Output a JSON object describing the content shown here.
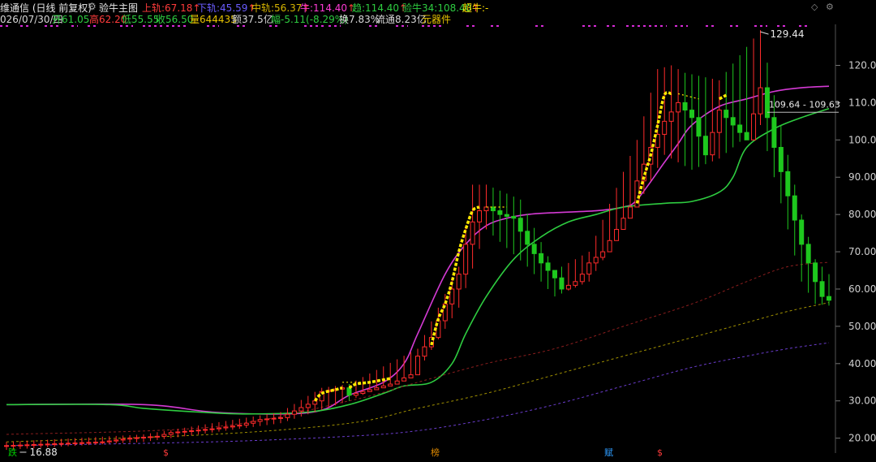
{
  "header": {
    "stock_title": "维通信 (日线 前复权)",
    "main_name": "验牛主图",
    "indicators": [
      {
        "label": "上轨:",
        "value": "67.18",
        "color": "#ff3b3b",
        "arrow": "↑",
        "arrow_color": "#ff3b3b"
      },
      {
        "label": "下轨:",
        "value": "45.59",
        "color": "#6a5cff",
        "arrow": "↑",
        "arrow_color": "#ff3b3b"
      },
      {
        "label": "中轨:",
        "value": "56.37",
        "color": "#d6b400",
        "arrow": "↑",
        "arrow_color": "#ff3b3b"
      },
      {
        "label": "牛:",
        "value": "114.40",
        "color": "#ff3bd5",
        "arrow": "↑",
        "arrow_color": "#ff3b3b"
      },
      {
        "label": "趋:",
        "value": "114.40",
        "color": "#2ecc40",
        "arrow": "↑",
        "arrow_color": "#ff3b3b"
      },
      {
        "label": "验牛34:",
        "value": "108.40",
        "color": "#2ecc40",
        "arrow": "↑",
        "arrow_color": "#ff3b3b"
      },
      {
        "label": "超牛:",
        "value": "-",
        "color": "#ffe000",
        "arrow": "",
        "arrow_color": "#ff3b3b"
      }
    ],
    "ohlc": {
      "date": "026/07/30/四",
      "open_label": "开",
      "open": "61.05",
      "high_label": "高",
      "high": "62.20",
      "low_label": "低",
      "low": "55.55",
      "close_label": "收",
      "close": "56.50",
      "vol_label": "量",
      "vol": "644435",
      "amount_label": "额",
      "amount": "37.5亿",
      "change_label": "幅",
      "change": "-5.11(-8.29%)",
      "turnover_label": "换",
      "turnover": "7.83%",
      "float_label": "流通",
      "float": "8.23亿",
      "sector": "元器件"
    }
  },
  "annotations": {
    "max_label": "129.44",
    "min_label": "16.88",
    "range_label": "109.64 - 109.63"
  },
  "bottom_markers": [
    {
      "text": "跌",
      "color": "#00c800",
      "pos": 0.006
    },
    {
      "text": "$",
      "color": "#ff3b3b",
      "pos": 0.197
    },
    {
      "text": "榜",
      "color": "#e08a00",
      "pos": 0.527
    },
    {
      "text": "赋",
      "color": "#2e9cff",
      "pos": 0.741
    },
    {
      "text": "$",
      "color": "#ff3b3b",
      "pos": 0.806
    }
  ],
  "chart_data": {
    "type": "candlestick",
    "y_ticks": [
      20,
      30,
      40,
      50,
      60,
      70,
      80,
      90,
      100,
      110,
      120
    ],
    "ylim": [
      16,
      131
    ],
    "y_tick_labels": [
      "20.00",
      "30.00",
      "40.00",
      "50.00",
      "60.00",
      "70.00",
      "80.00",
      "90.00",
      "100.00",
      "110.00",
      "120.00"
    ],
    "closes": [
      [
        0,
        18
      ],
      [
        14,
        19
      ],
      [
        18,
        20
      ],
      [
        22,
        20.5
      ],
      [
        24,
        21.5
      ],
      [
        30,
        22.5
      ],
      [
        34,
        23.5
      ],
      [
        37,
        25
      ],
      [
        40,
        25.5
      ],
      [
        45,
        30
      ],
      [
        46,
        32.5
      ],
      [
        49,
        33.5
      ],
      [
        50,
        31.5
      ],
      [
        53,
        33
      ],
      [
        56,
        34.5
      ],
      [
        59,
        37
      ],
      [
        60,
        42
      ],
      [
        62,
        47
      ],
      [
        64,
        56
      ],
      [
        66,
        64
      ],
      [
        67,
        72
      ],
      [
        68,
        78
      ],
      [
        69,
        81
      ],
      [
        70,
        82
      ],
      [
        72,
        80
      ],
      [
        74,
        79
      ],
      [
        76,
        72
      ],
      [
        78,
        67
      ],
      [
        80,
        63
      ],
      [
        81,
        60
      ],
      [
        83,
        62
      ],
      [
        84,
        64
      ],
      [
        85,
        67
      ],
      [
        87,
        70
      ],
      [
        89,
        76
      ],
      [
        91,
        82
      ],
      [
        92,
        89
      ],
      [
        94,
        98
      ],
      [
        96,
        105
      ],
      [
        98,
        110
      ],
      [
        100,
        106
      ],
      [
        102,
        96
      ],
      [
        104,
        108
      ],
      [
        106,
        104
      ],
      [
        108,
        100
      ],
      [
        110,
        114
      ],
      [
        112,
        98
      ],
      [
        114,
        85
      ],
      [
        116,
        72
      ],
      [
        118,
        62
      ],
      [
        119,
        58
      ],
      [
        120,
        57
      ]
    ],
    "highs": [
      [
        0,
        19
      ],
      [
        20,
        21
      ],
      [
        40,
        27
      ],
      [
        46,
        33.5
      ],
      [
        50,
        34.5
      ],
      [
        60,
        44
      ],
      [
        66,
        66
      ],
      [
        68,
        88
      ],
      [
        70,
        88
      ],
      [
        75,
        84
      ],
      [
        80,
        65
      ],
      [
        85,
        70
      ],
      [
        92,
        100
      ],
      [
        95,
        119
      ],
      [
        97,
        120
      ],
      [
        99,
        118
      ],
      [
        104,
        116
      ],
      [
        110,
        129.44
      ],
      [
        112,
        112
      ],
      [
        116,
        80
      ],
      [
        118,
        68
      ],
      [
        120,
        64
      ]
    ],
    "lows": [
      [
        0,
        16.88
      ],
      [
        20,
        19
      ],
      [
        40,
        24
      ],
      [
        50,
        30
      ],
      [
        60,
        38
      ],
      [
        66,
        55
      ],
      [
        70,
        76
      ],
      [
        76,
        66
      ],
      [
        80,
        58
      ],
      [
        85,
        62
      ],
      [
        92,
        82
      ],
      [
        96,
        96
      ],
      [
        100,
        92
      ],
      [
        104,
        95
      ],
      [
        110,
        104
      ],
      [
        112,
        90
      ],
      [
        116,
        62
      ],
      [
        118,
        56
      ],
      [
        120,
        55.55
      ]
    ],
    "series": [
      {
        "name": "牛",
        "color": "#d43ad4",
        "style": "solid",
        "points": [
          [
            0,
            29
          ],
          [
            20,
            29
          ],
          [
            30,
            27
          ],
          [
            40,
            26.5
          ],
          [
            46,
            27.5
          ],
          [
            50,
            31.5
          ],
          [
            55,
            35
          ],
          [
            58,
            40
          ],
          [
            60,
            48
          ],
          [
            64,
            64
          ],
          [
            67,
            72
          ],
          [
            70,
            77
          ],
          [
            73,
            79
          ],
          [
            76,
            80
          ],
          [
            80,
            80.5
          ],
          [
            86,
            81
          ],
          [
            90,
            82
          ],
          [
            92,
            84
          ],
          [
            96,
            94
          ],
          [
            98,
            99
          ],
          [
            100,
            104
          ],
          [
            104,
            109
          ],
          [
            108,
            111
          ],
          [
            112,
            113
          ],
          [
            116,
            114
          ],
          [
            120,
            114.4
          ]
        ]
      },
      {
        "name": "趋",
        "color": "#2ecc40",
        "style": "solid",
        "points": [
          [
            0,
            29
          ],
          [
            15,
            29
          ],
          [
            20,
            28
          ],
          [
            28,
            27
          ],
          [
            35,
            26.5
          ],
          [
            44,
            27
          ],
          [
            50,
            29
          ],
          [
            55,
            32
          ],
          [
            58,
            34
          ],
          [
            62,
            35
          ],
          [
            65,
            40
          ],
          [
            67,
            48
          ],
          [
            70,
            58
          ],
          [
            74,
            68
          ],
          [
            78,
            74
          ],
          [
            82,
            78
          ],
          [
            86,
            80
          ],
          [
            90,
            82
          ],
          [
            96,
            83
          ],
          [
            100,
            83.5
          ],
          [
            104,
            86
          ],
          [
            106,
            90
          ],
          [
            108,
            98
          ],
          [
            112,
            103
          ],
          [
            116,
            106
          ],
          [
            120,
            108.4
          ]
        ]
      },
      {
        "name": "上轨",
        "color": "#8c1e1e",
        "style": "dashed",
        "points": [
          [
            0,
            21
          ],
          [
            30,
            23
          ],
          [
            50,
            30
          ],
          [
            60,
            35
          ],
          [
            70,
            40
          ],
          [
            80,
            44
          ],
          [
            90,
            50
          ],
          [
            100,
            56
          ],
          [
            108,
            62
          ],
          [
            114,
            66
          ],
          [
            120,
            67.18
          ]
        ]
      },
      {
        "name": "中轨",
        "color": "#a09000",
        "style": "dashed",
        "points": [
          [
            0,
            19
          ],
          [
            30,
            21
          ],
          [
            50,
            24
          ],
          [
            60,
            28
          ],
          [
            70,
            32
          ],
          [
            80,
            37
          ],
          [
            90,
            42
          ],
          [
            100,
            47
          ],
          [
            108,
            51
          ],
          [
            114,
            54
          ],
          [
            120,
            56.37
          ]
        ]
      },
      {
        "name": "下轨",
        "color": "#6a3ccc",
        "style": "dashed",
        "points": [
          [
            0,
            18
          ],
          [
            30,
            19
          ],
          [
            50,
            20.5
          ],
          [
            60,
            22
          ],
          [
            70,
            25
          ],
          [
            80,
            29
          ],
          [
            90,
            34
          ],
          [
            100,
            39
          ],
          [
            108,
            42
          ],
          [
            114,
            44
          ],
          [
            120,
            45.59
          ]
        ]
      }
    ],
    "yellow_segments": [
      [
        [
          45,
          30
        ],
        [
          46,
          32
        ],
        [
          48,
          33
        ],
        [
          49,
          33.5
        ]
      ],
      [
        [
          50,
          33.5
        ],
        [
          51,
          34.5
        ],
        [
          53,
          35
        ],
        [
          56,
          36
        ]
      ],
      [
        [
          62,
          45
        ],
        [
          63,
          52
        ],
        [
          64,
          56
        ],
        [
          65,
          62
        ],
        [
          66,
          70
        ],
        [
          67,
          76
        ],
        [
          68,
          81
        ],
        [
          69,
          82
        ]
      ],
      [
        [
          92,
          83
        ],
        [
          93,
          90
        ],
        [
          94,
          96
        ],
        [
          95,
          104
        ],
        [
          96,
          112
        ],
        [
          97,
          112.4
        ]
      ],
      [
        [
          104,
          111
        ],
        [
          105,
          112
        ]
      ]
    ],
    "yellow_dotted": [
      [
        [
          49,
          35
        ],
        [
          52,
          35
        ]
      ],
      [
        [
          70,
          82
        ],
        [
          73,
          82
        ]
      ],
      [
        [
          98,
          112.4
        ],
        [
          101,
          111
        ]
      ]
    ]
  }
}
